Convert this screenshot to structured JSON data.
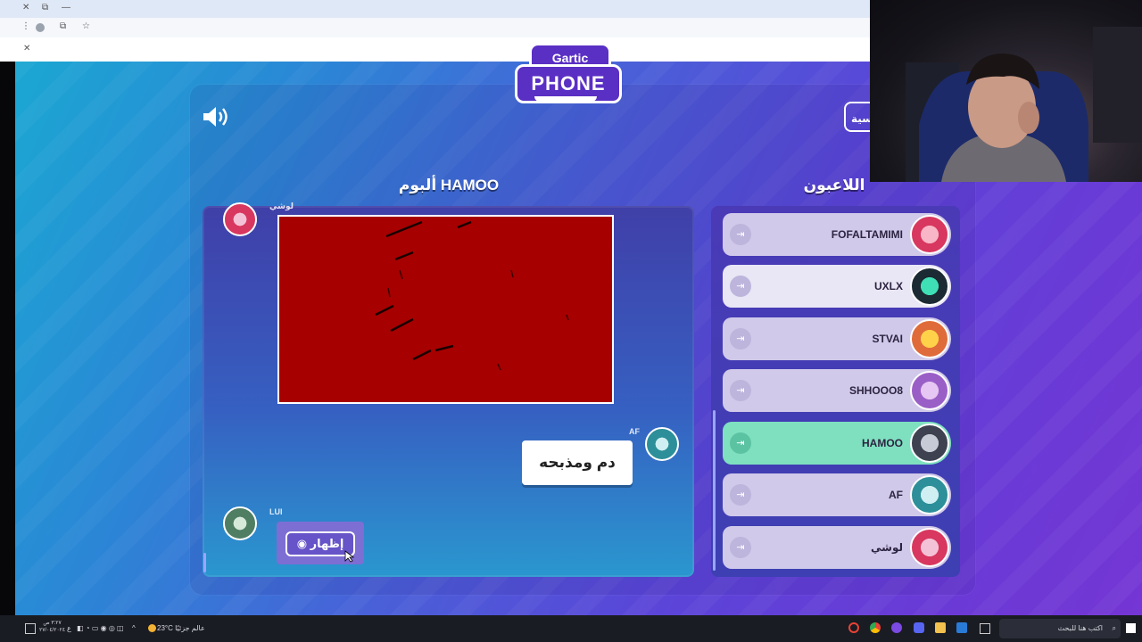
{
  "game": {
    "logo_top": "Gartic",
    "logo_bottom": "PHONE",
    "album_title": "ألبوم HAMOO",
    "players_title": "اللاعبون",
    "side_tab_label": "سية"
  },
  "album": {
    "drawing_author": "لوشي",
    "guess_author": "AF",
    "guess_text": "دم ومذبحه",
    "next_author": "LUI",
    "reveal_button": "إظهار"
  },
  "players": [
    {
      "name": "FOFALTAMIMI",
      "state": "normal"
    },
    {
      "name": "UXLX",
      "state": "highlight"
    },
    {
      "name": "STVAI",
      "state": "normal"
    },
    {
      "name": "SHHOOO8",
      "state": "normal"
    },
    {
      "name": "HAMOO",
      "state": "active"
    },
    {
      "name": "AF",
      "state": "normal"
    },
    {
      "name": "لوشي",
      "state": "normal"
    }
  ],
  "taskbar": {
    "search_placeholder": "اكتب هنا للبحث",
    "weather": "23°C عالم جزئيًا",
    "time": "٣:٢٧ ص",
    "date": "٢٧/٠٤/٢٠٢٤",
    "lang": "ع"
  },
  "colors": {
    "accent": "#6a3ad6",
    "drawing_bg": "#a70000",
    "active_row": "#7fe0c0"
  }
}
